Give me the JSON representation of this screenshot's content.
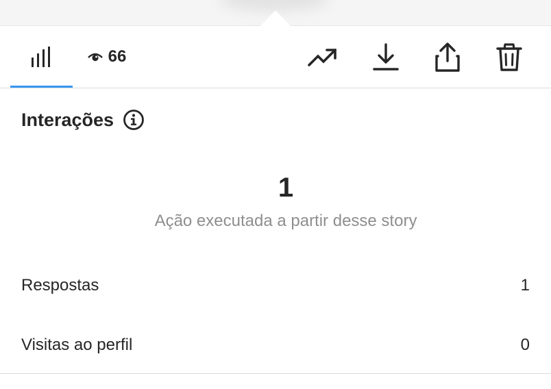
{
  "toolbar": {
    "views_count": "66",
    "tabs": [
      {
        "name": "stats",
        "icon": "bar-chart-icon",
        "active": true
      },
      {
        "name": "views",
        "icon": "eye-icon"
      }
    ],
    "actions": [
      {
        "icon": "trending-up-icon"
      },
      {
        "icon": "download-icon"
      },
      {
        "icon": "share-icon"
      },
      {
        "icon": "trash-icon"
      }
    ]
  },
  "interactions": {
    "title": "Interações",
    "summary_value": "1",
    "summary_caption": "Ação executada a partir desse story",
    "rows": [
      {
        "label": "Respostas",
        "value": "1"
      },
      {
        "label": "Visitas ao perfil",
        "value": "0"
      }
    ]
  },
  "colors": {
    "accent": "#3897f0",
    "text": "#262626",
    "muted": "#8e8e8e",
    "divider": "#dbdbdb"
  }
}
